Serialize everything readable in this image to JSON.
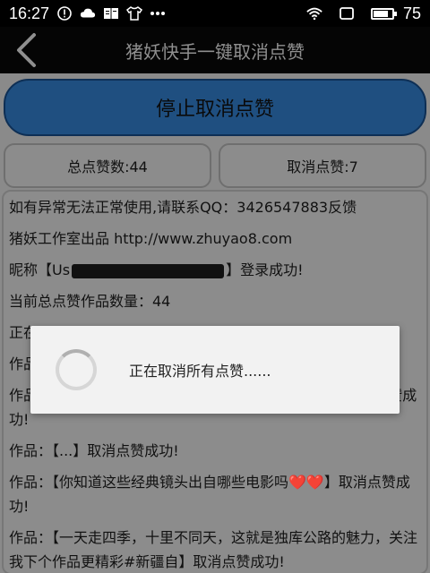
{
  "status_bar": {
    "time": "16:27",
    "battery": "75",
    "battery_level": 0.75,
    "icons": [
      "alert-icon",
      "cloud-icon",
      "book-icon",
      "shirt-icon",
      "more-icon",
      "wifi-icon",
      "screen-icon"
    ]
  },
  "header": {
    "title": "猪妖快手一键取消点赞"
  },
  "main": {
    "stop_button": "停止取消点赞",
    "total_likes": "总点赞数:44",
    "cancelled_likes": "取消点赞:7"
  },
  "log": {
    "line1": "如有异常无法正常使用,请联系QQ：3426547883反馈",
    "line2": "猪妖工作室出品 http://www.zhuyao8.com",
    "line3_prefix": "昵称【Us",
    "line3_suffix": "】登录成功!",
    "line4": "当前总点赞作品数量：44",
    "line5": "正在",
    "line6": "作品",
    "line7": "作品：【...遇到古天乐，你想对他说的第一句话是什】取消点赞成功!",
    "line8": "作品：【...】取消点赞成功!",
    "line9": "作品：【你知道这些经典镜头出自哪些电影吗❤️❤️】取消点赞成功!",
    "line10": "作品：【一天走四季，十里不同天，这就是独库公路的魅力，关注我下个作品更精彩#新疆自】取消点赞成功!"
  },
  "dialog": {
    "message": "正在取消所有点赞......"
  },
  "colors": {
    "stop_button_bg": "#1f4f80",
    "titlebar_bg": "#050505"
  }
}
